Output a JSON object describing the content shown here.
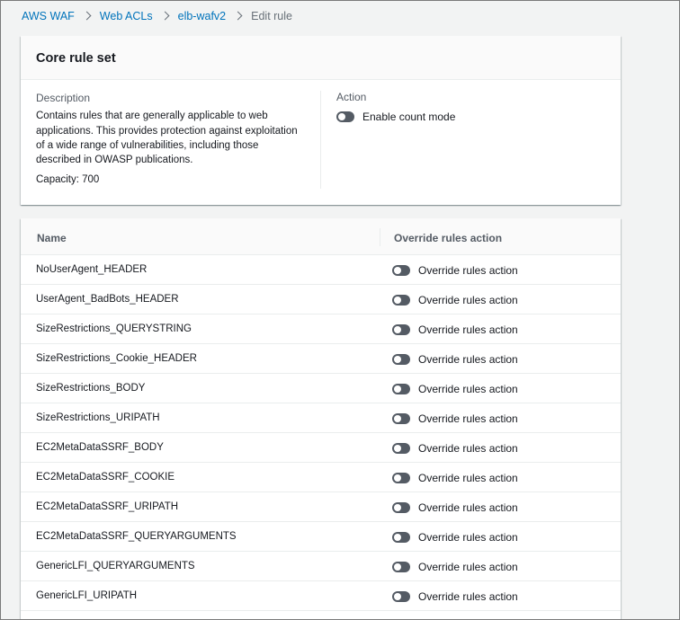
{
  "breadcrumb": {
    "items": [
      "AWS WAF",
      "Web ACLs",
      "elb-wafv2"
    ],
    "current": "Edit rule"
  },
  "rule_card": {
    "title": "Core rule set",
    "description_label": "Description",
    "description": "Contains rules that are generally applicable to web applications. This provides protection against exploitation of a wide range of vulnerabilities, including those described in OWASP publications.",
    "capacity": "Capacity: 700",
    "action_label": "Action",
    "count_mode_label": "Enable count mode"
  },
  "table": {
    "col_name": "Name",
    "col_action": "Override rules action",
    "rows": [
      {
        "name": "NoUserAgent_HEADER",
        "action": "Override rules action"
      },
      {
        "name": "UserAgent_BadBots_HEADER",
        "action": "Override rules action"
      },
      {
        "name": "SizeRestrictions_QUERYSTRING",
        "action": "Override rules action"
      },
      {
        "name": "SizeRestrictions_Cookie_HEADER",
        "action": "Override rules action"
      },
      {
        "name": "SizeRestrictions_BODY",
        "action": "Override rules action"
      },
      {
        "name": "SizeRestrictions_URIPATH",
        "action": "Override rules action"
      },
      {
        "name": "EC2MetaDataSSRF_BODY",
        "action": "Override rules action"
      },
      {
        "name": "EC2MetaDataSSRF_COOKIE",
        "action": "Override rules action"
      },
      {
        "name": "EC2MetaDataSSRF_URIPATH",
        "action": "Override rules action"
      },
      {
        "name": "EC2MetaDataSSRF_QUERYARGUMENTS",
        "action": "Override rules action"
      },
      {
        "name": "GenericLFI_QUERYARGUMENTS",
        "action": "Override rules action"
      },
      {
        "name": "GenericLFI_URIPATH",
        "action": "Override rules action"
      }
    ]
  }
}
